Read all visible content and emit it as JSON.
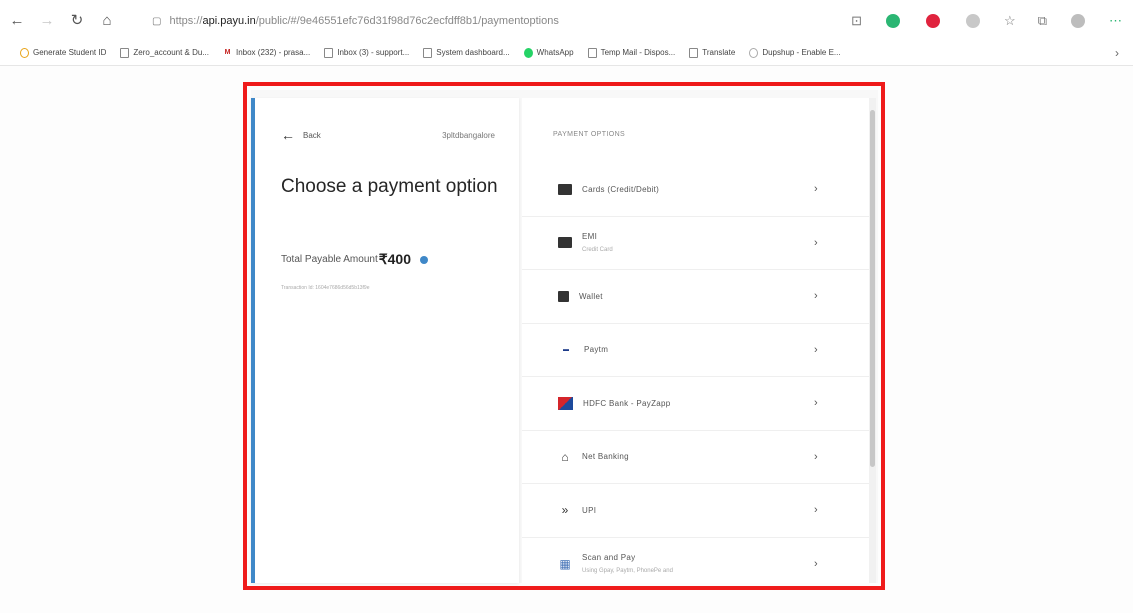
{
  "browser": {
    "url_prefix": "https://",
    "url_host": "api.payu.in",
    "url_path": "/public/#/9e46551efc76d31f98d76c2ecfdff8b1/paymentoptions",
    "bookmarks": [
      {
        "label": "Generate Student ID"
      },
      {
        "label": "Zero_account & Du..."
      },
      {
        "label": "Inbox (232) - prasa..."
      },
      {
        "label": "Inbox (3) - support..."
      },
      {
        "label": "System dashboard..."
      },
      {
        "label": "WhatsApp"
      },
      {
        "label": "Temp Mail - Dispos..."
      },
      {
        "label": "Translate"
      },
      {
        "label": "Dupshup - Enable E..."
      }
    ]
  },
  "left": {
    "back_label": "Back",
    "merchant": "3pltdbangalore",
    "title": "Choose a payment option",
    "amount_label": "Total Payable Amount",
    "amount_value": "₹400",
    "transaction_id": "Transaction Id: 1604e7686d56d5b13f9e"
  },
  "right": {
    "section_label": "PAYMENT OPTIONS",
    "options": [
      {
        "label": "Cards (Credit/Debit)",
        "sub": "",
        "icon": "card-icon"
      },
      {
        "label": "EMI",
        "sub": "Credit Card",
        "icon": "emi-icon"
      },
      {
        "label": "Wallet",
        "sub": "",
        "icon": "wallet-icon"
      },
      {
        "label": "Paytm",
        "sub": "",
        "icon": "paytm-icon"
      },
      {
        "label": "HDFC Bank - PayZapp",
        "sub": "",
        "icon": "payzapp-icon"
      },
      {
        "label": "Net Banking",
        "sub": "",
        "icon": "bank-icon"
      },
      {
        "label": "UPI",
        "sub": "",
        "icon": "upi-icon"
      },
      {
        "label": "Scan and Pay",
        "sub": "Using Gpay, Paytm, PhonePe and",
        "icon": "qr-icon"
      }
    ]
  },
  "colors": {
    "highlight": "#ef1b1b",
    "accent": "#3f88c8"
  }
}
